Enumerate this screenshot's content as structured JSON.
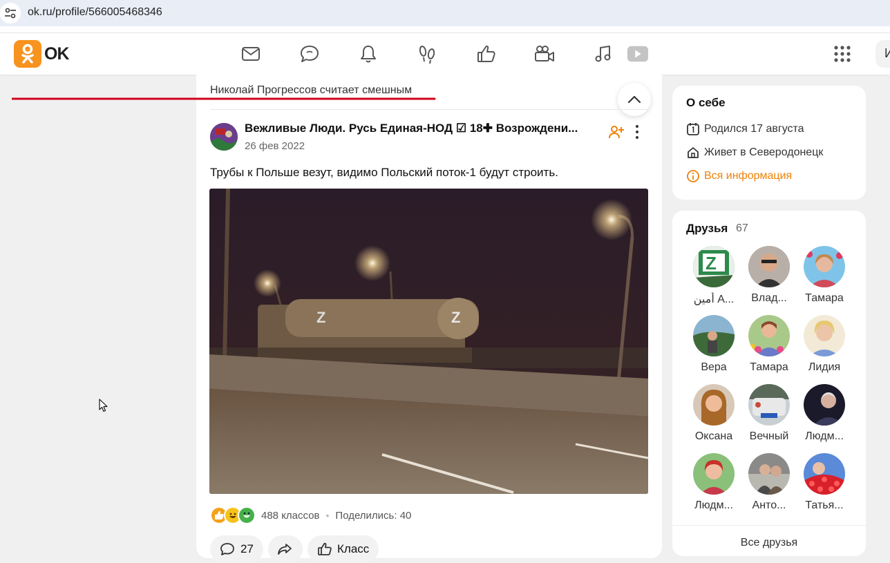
{
  "browser": {
    "url": "ok.ru/profile/566005468346",
    "tune_icon": "tune-icon"
  },
  "header": {
    "logo_text": "OK",
    "search_stub": "И",
    "nav_icons": [
      "mail-icon",
      "chat-icon",
      "bell-icon",
      "footprints-icon",
      "like-icon",
      "camera-icon",
      "music-icon",
      "video-icon"
    ],
    "apps_icon": "grid-icon"
  },
  "feed": {
    "reshare_text": "Николай Прогрессов считает смешным",
    "group_name": "Вежливые Люди. Русь Единая-НОД ☑ 18✚ Возрождени...",
    "date": "26 фев 2022",
    "text": "Трубы к Польше везут, видимо Польский поток-1 будут строить.",
    "reactions_count": "488 классов",
    "shares": "Поделились: 40",
    "comments_count": "27",
    "klass_label": "Класс"
  },
  "about": {
    "title": "О себе",
    "born": "Родился 17 августа",
    "lives": "Живет в Северодонецк",
    "all_info": "Вся информация"
  },
  "friends": {
    "title": "Друзья",
    "count": "67",
    "all": "Все друзья",
    "list": [
      {
        "name": "أمين А..."
      },
      {
        "name": "Влад..."
      },
      {
        "name": "Тамара"
      },
      {
        "name": "Вера"
      },
      {
        "name": "Тамара"
      },
      {
        "name": "Лидия"
      },
      {
        "name": "Оксана"
      },
      {
        "name": "Вечный"
      },
      {
        "name": "Людм..."
      },
      {
        "name": "Людм..."
      },
      {
        "name": "Анто..."
      },
      {
        "name": "Татья..."
      }
    ]
  },
  "colors": {
    "brand": "#f7931e",
    "accent_red": "#d0021b",
    "link_orange": "#ee8208"
  }
}
